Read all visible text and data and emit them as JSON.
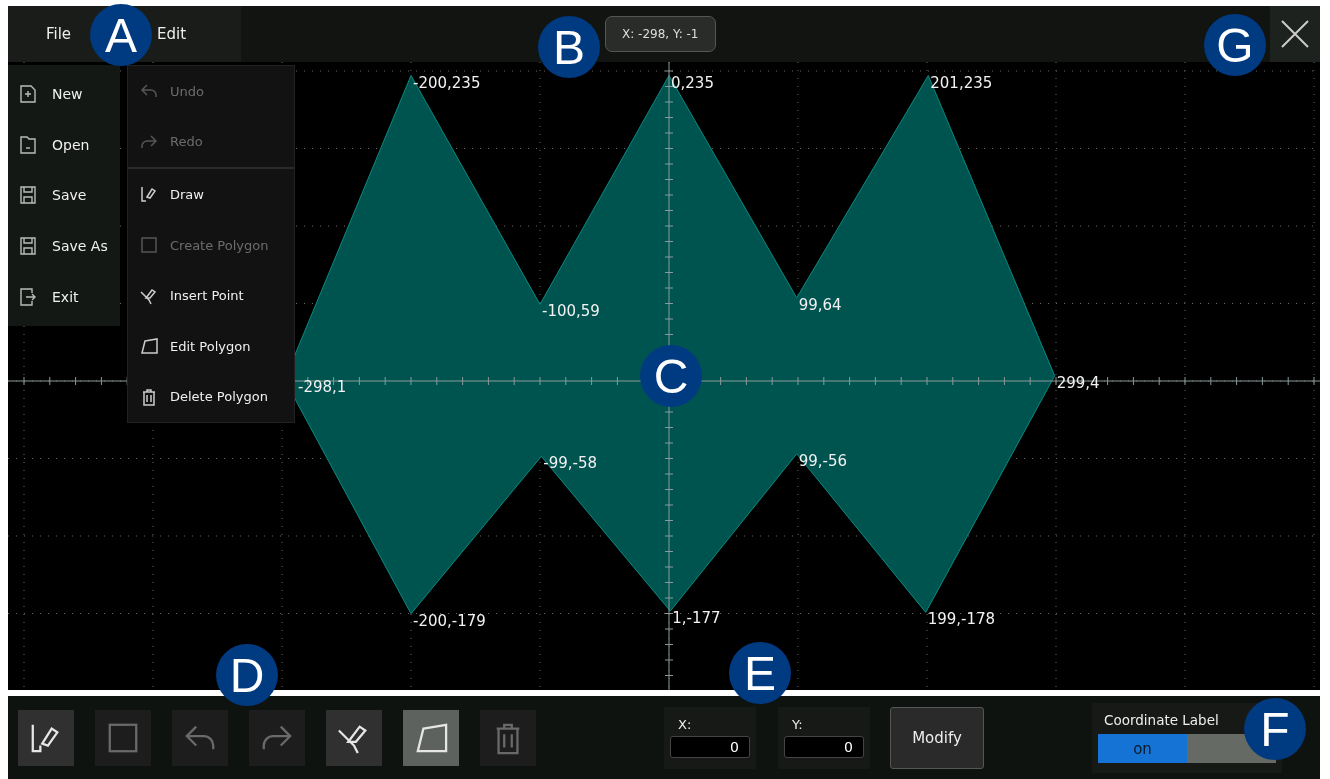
{
  "menubar": [
    {
      "label": "File"
    },
    {
      "label": "Edit"
    }
  ],
  "cursor_readout": "X: -298, Y: -1",
  "file_menu": [
    {
      "label": "New"
    },
    {
      "label": "Open"
    },
    {
      "label": "Save"
    },
    {
      "label": "Save As"
    },
    {
      "label": "Exit"
    }
  ],
  "edit_menu": [
    {
      "label": "Undo",
      "disabled": true,
      "separator": false
    },
    {
      "label": "Redo",
      "disabled": true,
      "separator": false
    },
    {
      "label": "Draw",
      "disabled": false,
      "separator": true
    },
    {
      "label": "Create Polygon",
      "disabled": true,
      "separator": false
    },
    {
      "label": "Insert Point",
      "disabled": false,
      "separator": false
    },
    {
      "label": "Edit Polygon",
      "disabled": false,
      "separator": false
    },
    {
      "label": "Delete Polygon",
      "disabled": false,
      "separator": false
    }
  ],
  "polygon_vertices": [
    {
      "label": "-298,1"
    },
    {
      "label": "-200,235"
    },
    {
      "label": "-100,59"
    },
    {
      "label": "0,235"
    },
    {
      "label": "99,64"
    },
    {
      "label": "201,235"
    },
    {
      "label": "299,4"
    },
    {
      "label": "199,-178"
    },
    {
      "label": "99,-56"
    },
    {
      "label": "1,-177"
    },
    {
      "label": "-99,-58"
    },
    {
      "label": "-200,-179"
    }
  ],
  "toolbar": [
    {
      "disabled": false,
      "selected": false
    },
    {
      "disabled": true,
      "selected": false
    },
    {
      "disabled": true,
      "selected": false
    },
    {
      "disabled": true,
      "selected": false
    },
    {
      "disabled": false,
      "selected": false
    },
    {
      "disabled": false,
      "selected": true
    },
    {
      "disabled": true,
      "selected": false
    }
  ],
  "point_editor": {
    "x_label": "X:",
    "x_value": "0",
    "y_label": "Y:",
    "y_value": "0",
    "button": "Modify"
  },
  "coordinate_label": {
    "title": "Coordinate Label",
    "on_label": "on",
    "on": true
  },
  "callouts": [
    {
      "letter": "A"
    },
    {
      "letter": "B"
    },
    {
      "letter": "C"
    },
    {
      "letter": "D"
    },
    {
      "letter": "E"
    },
    {
      "letter": "F"
    },
    {
      "letter": "G"
    }
  ]
}
